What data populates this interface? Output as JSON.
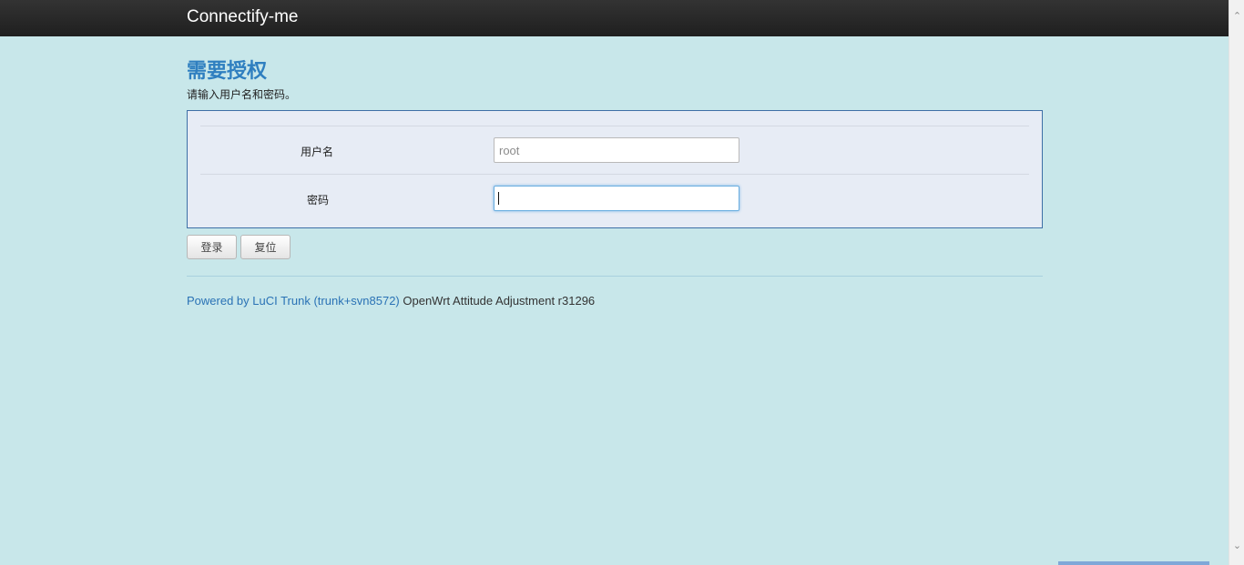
{
  "header": {
    "brand": "Connectify-me"
  },
  "auth": {
    "title": "需要授权",
    "description": "请输入用户名和密码。",
    "username": {
      "label": "用户名",
      "placeholder": "root",
      "value": ""
    },
    "password": {
      "label": "密码",
      "value": ""
    }
  },
  "buttons": {
    "login": "登录",
    "reset": "复位"
  },
  "footer": {
    "powered_link": "Powered by LuCI Trunk (trunk+svn8572)",
    "version": " OpenWrt Attitude Adjustment r31296"
  },
  "scrollbar": {
    "up_icon": "chevron-up-icon",
    "down_icon": "chevron-down-icon"
  },
  "colors": {
    "background": "#c8e7ea",
    "header": "#262626",
    "title": "#2f7fc0",
    "panel": "#e7ecf5",
    "link": "#2a72b5"
  }
}
